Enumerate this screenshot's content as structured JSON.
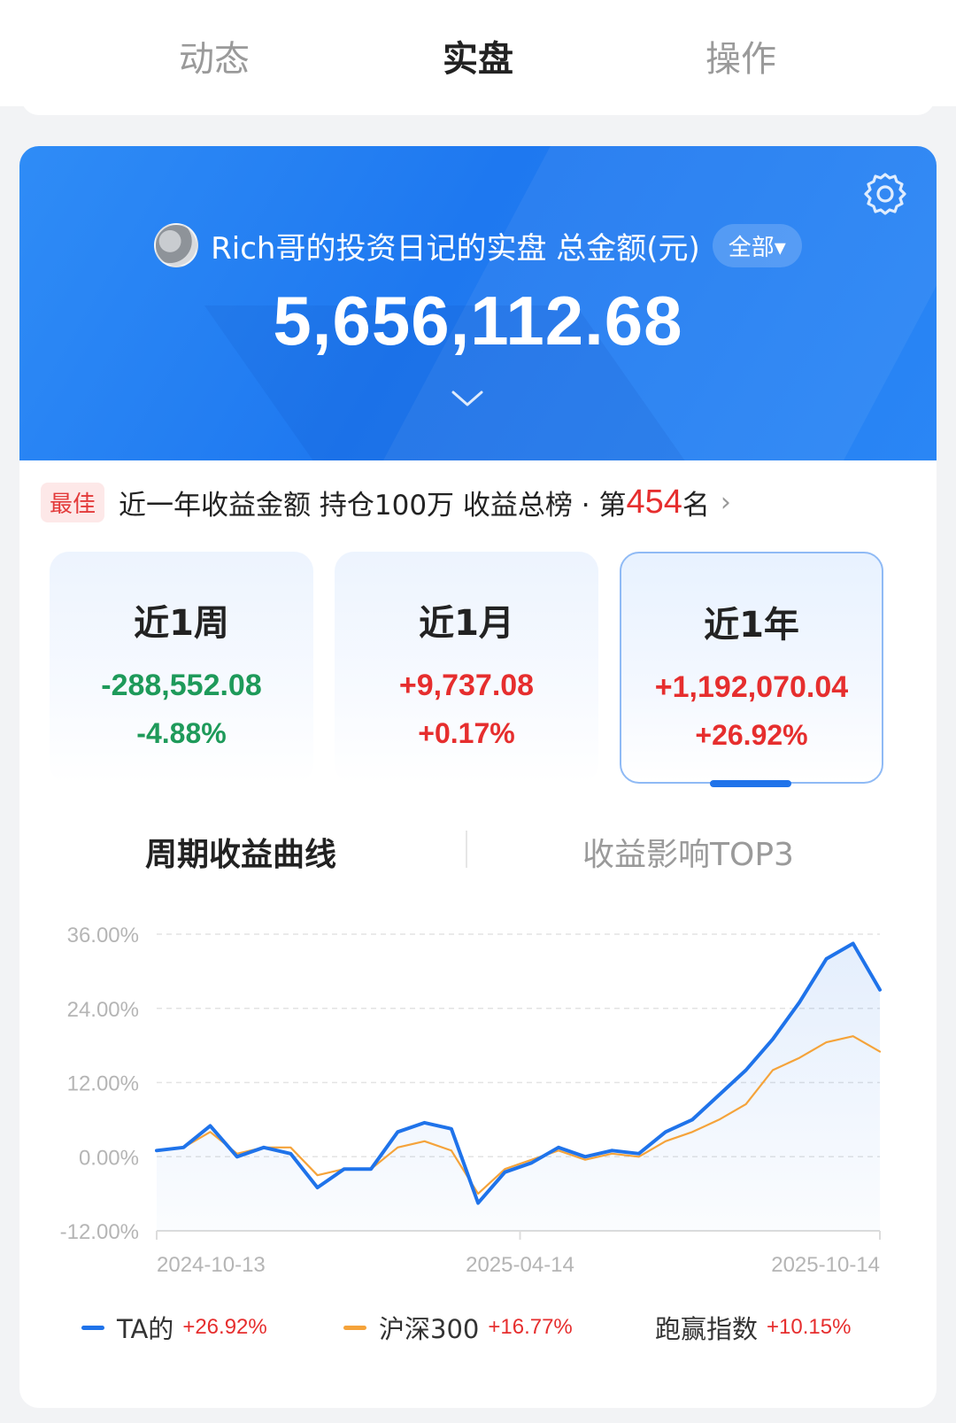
{
  "top_tabs": {
    "items": [
      {
        "label": "动态"
      },
      {
        "label": "实盘"
      },
      {
        "label": "操作"
      }
    ],
    "active_index": 1
  },
  "hero": {
    "title": "Rich哥的投资日记的实盘 总金额(元)",
    "scope_label": "全部▾",
    "total_amount": "5,656,112.68",
    "background_color": "#1e78f0",
    "icons": [
      "settings-gear-icon",
      "chevron-down-icon"
    ]
  },
  "ranking": {
    "badge": "最佳",
    "text": "近一年收益金额 持仓100万 收益总榜 · 第",
    "rank": "454",
    "suffix": "名",
    "arrow": "›"
  },
  "periods": [
    {
      "label": "近1周",
      "amount": "-288,552.08",
      "percent": "-4.88%",
      "trend": "down"
    },
    {
      "label": "近1月",
      "amount": "+9,737.08",
      "percent": "+0.17%",
      "trend": "up"
    },
    {
      "label": "近1年",
      "amount": "+1,192,070.04",
      "percent": "+26.92%",
      "trend": "up"
    }
  ],
  "selected_period_index": 2,
  "sub_tabs": {
    "active": "周期收益曲线",
    "inactive": "收益影响TOP3"
  },
  "chart_data": {
    "type": "line",
    "xlabel": "",
    "ylabel": "",
    "ylim": [
      -12,
      36
    ],
    "y_ticks": [
      "36.00%",
      "24.00%",
      "12.00%",
      "0.00%",
      "-12.00%"
    ],
    "x_tick_labels": [
      "2024-10-13",
      "2025-04-14",
      "2025-10-14"
    ],
    "x": [
      "2024-10-13",
      "2024-10-27",
      "2024-11-10",
      "2024-11-24",
      "2024-12-08",
      "2024-12-22",
      "2025-01-05",
      "2025-01-19",
      "2025-02-02",
      "2025-02-16",
      "2025-03-02",
      "2025-03-16",
      "2025-03-30",
      "2025-04-14",
      "2025-04-28",
      "2025-05-12",
      "2025-05-26",
      "2025-06-09",
      "2025-06-23",
      "2025-07-07",
      "2025-07-21",
      "2025-08-04",
      "2025-08-18",
      "2025-09-01",
      "2025-09-15",
      "2025-09-29",
      "2025-10-14"
    ],
    "series": [
      {
        "name": "TA的",
        "color": "#1f73ea",
        "values": [
          1.0,
          1.5,
          5.0,
          0.0,
          1.5,
          0.5,
          -5.0,
          -2.0,
          -2.0,
          4.0,
          5.5,
          4.5,
          -7.5,
          -2.5,
          -1.0,
          1.5,
          0.0,
          1.0,
          0.5,
          4.0,
          6.0,
          10.0,
          14.0,
          19.0,
          25.0,
          32.0,
          34.5,
          27.0
        ]
      },
      {
        "name": "沪深300",
        "color": "#f5a33a",
        "values": [
          1.0,
          1.5,
          4.0,
          0.5,
          1.5,
          1.5,
          -3.0,
          -2.0,
          -2.0,
          1.5,
          2.5,
          1.0,
          -6.0,
          -2.0,
          -0.5,
          1.0,
          -0.5,
          0.5,
          0.0,
          2.5,
          4.0,
          6.0,
          8.5,
          14.0,
          16.0,
          18.5,
          19.5,
          17.0
        ]
      }
    ],
    "legend": [
      {
        "name": "TA的",
        "value": "+26.92%",
        "color": "#1f73ea"
      },
      {
        "name": "沪深300",
        "value": "+16.77%",
        "color": "#f5a33a"
      },
      {
        "name": "跑赢指数",
        "value": "+10.15%",
        "color": ""
      }
    ]
  }
}
